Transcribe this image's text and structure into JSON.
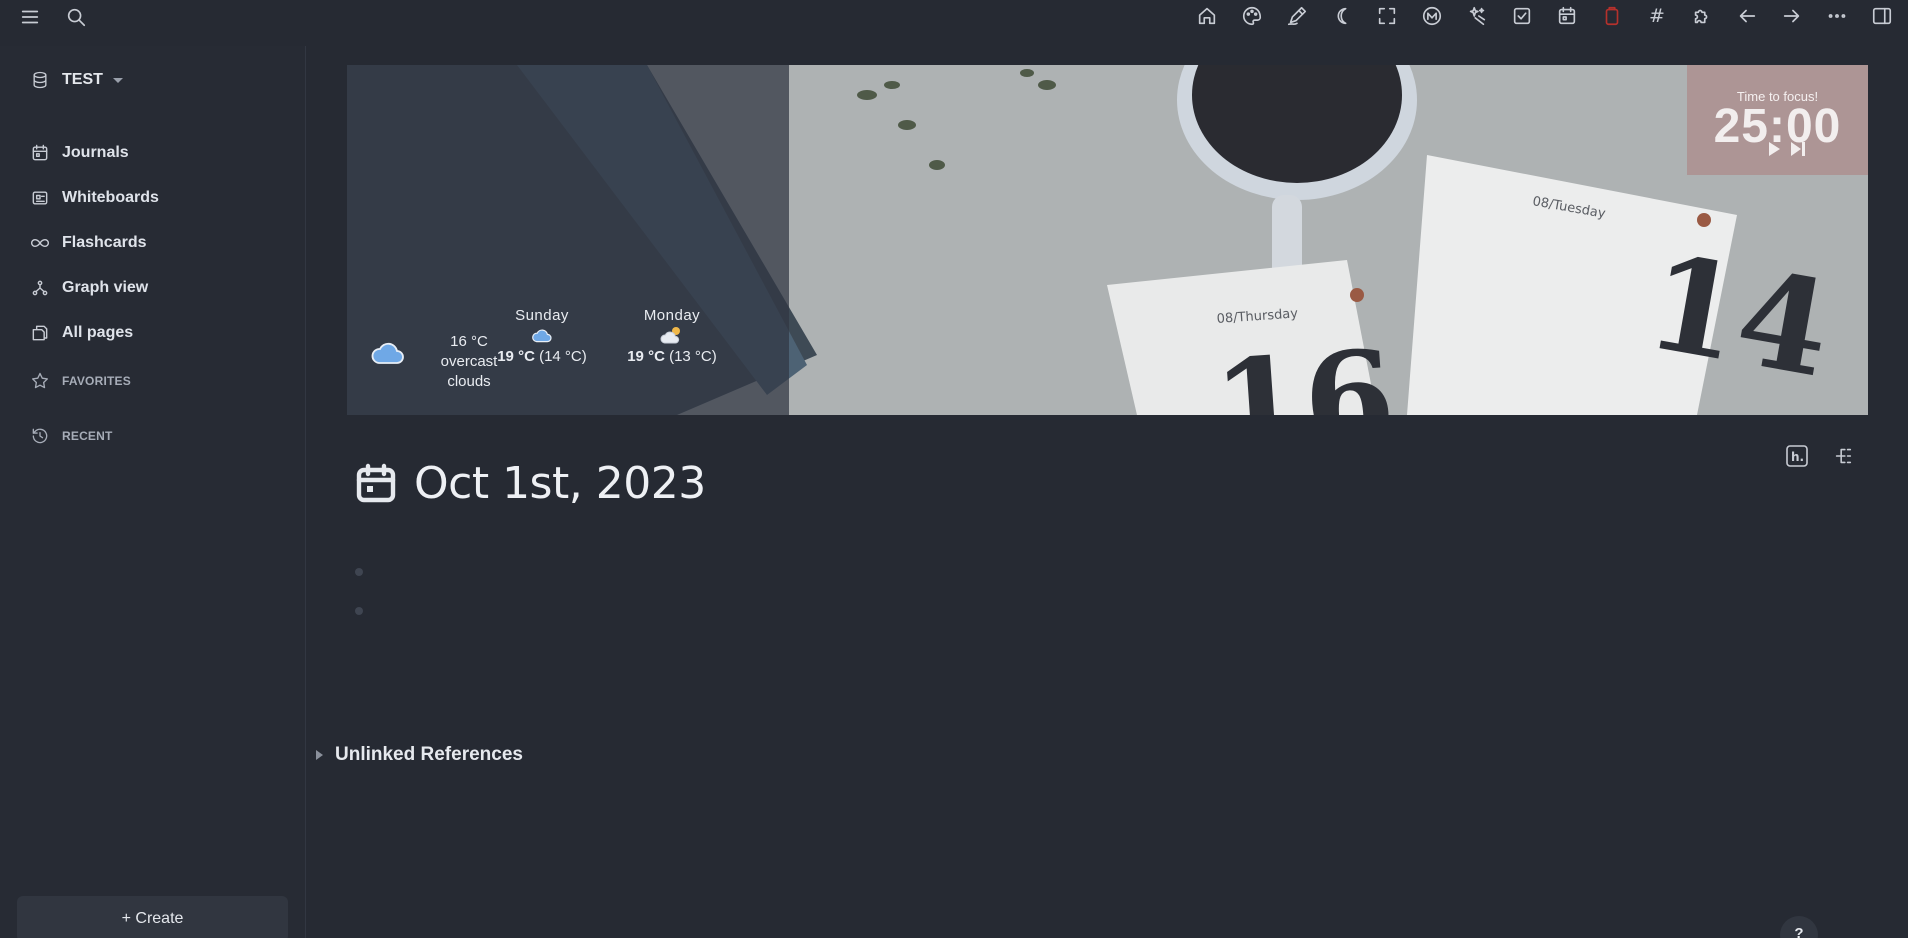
{
  "graph": {
    "name": "TEST"
  },
  "sidebar": {
    "items": [
      {
        "label": "Journals",
        "icon": "calendar-icon"
      },
      {
        "label": "Whiteboards",
        "icon": "whiteboard-icon"
      },
      {
        "label": "Flashcards",
        "icon": "infinity-icon"
      },
      {
        "label": "Graph view",
        "icon": "graph-icon"
      },
      {
        "label": "All pages",
        "icon": "pages-icon"
      }
    ],
    "favorites_label": "FAVORITES",
    "recent_label": "RECENT",
    "create_label": "+ Create"
  },
  "toolbar": {
    "left_icons": [
      "menu-icon",
      "search-icon"
    ],
    "right_icons": [
      "home-icon",
      "palette-icon",
      "pencil-icon",
      "moon-icon",
      "fullscreen-icon",
      "markdown-icon",
      "stars-icon",
      "checkbox-icon",
      "calendar-icon",
      "clipboard-icon",
      "hash-icon",
      "puzzle-icon",
      "arrow-left-icon",
      "arrow-right-icon",
      "more-icon",
      "sidebar-icon"
    ],
    "hash": "#"
  },
  "weather": {
    "current": {
      "temp": "16 °C",
      "desc_line1": "overcast",
      "desc_line2": "clouds",
      "icon": "cloud-icon"
    },
    "forecast": [
      {
        "day": "Sunday",
        "high": "19 °C",
        "low": "(14 °C)",
        "icon": "cloud-icon"
      },
      {
        "day": "Monday",
        "high": "19 °C",
        "low": "(13 °C)",
        "icon": "partly-sunny-icon"
      }
    ]
  },
  "pomodoro": {
    "title": "Time to focus!",
    "time": "25:00"
  },
  "page": {
    "title": "Oct 1st, 2023",
    "unlinked_refs": "Unlinked References",
    "help": "?"
  },
  "colors": {
    "background": "#262a33",
    "sidebar": "#272b34",
    "pomodoro": "#ac9292",
    "weather_icon": "#6fa8e6",
    "clipboard_icon": "#b5312c"
  }
}
